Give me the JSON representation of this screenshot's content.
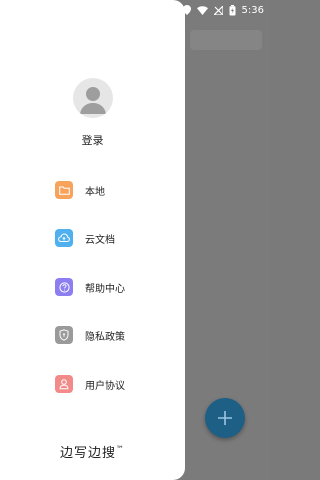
{
  "status": {
    "time": "5:36"
  },
  "drawer": {
    "login_label": "登录",
    "items": [
      {
        "label": "本地",
        "icon": "folder-icon",
        "color": "#f7a35c"
      },
      {
        "label": "云文档",
        "icon": "cloud-icon",
        "color": "#4fb0f0"
      },
      {
        "label": "帮助中心",
        "icon": "help-icon",
        "color": "#8c7ef0"
      },
      {
        "label": "隐私政策",
        "icon": "shield-icon",
        "color": "#9a9a9a"
      },
      {
        "label": "用户协议",
        "icon": "user-agreement-icon",
        "color": "#f28a8a"
      }
    ],
    "brand_name": "边写边搜",
    "brand_tm": "™"
  },
  "fab": {
    "icon": "plus-icon",
    "color": "#1e5f86"
  }
}
